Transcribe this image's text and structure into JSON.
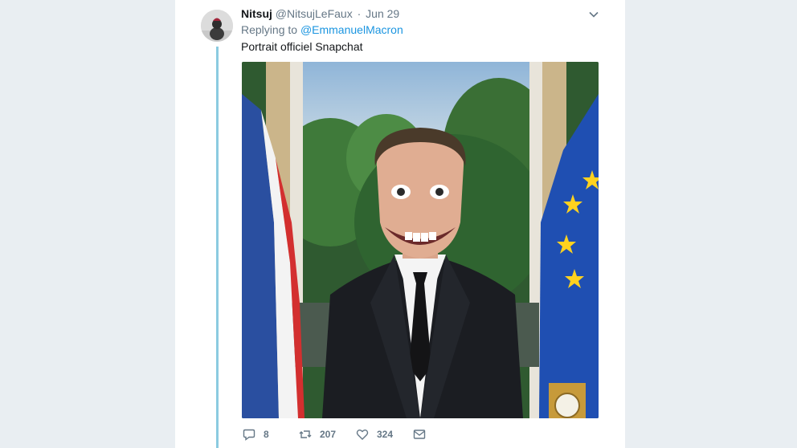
{
  "tweet": {
    "author_name": "Nitsuj",
    "author_handle": "@NitsujLeFaux",
    "separator": "·",
    "date": "Jun 29",
    "replying_prefix": "Replying to",
    "replying_to": "@EmmanuelMacron",
    "text": "Portrait officiel Snapchat",
    "media_icon": "photo",
    "thread_color": "#8bcbe0",
    "mention_color": "#1b95e0"
  },
  "actions": {
    "reply_icon": "comment-icon",
    "reply_count": "8",
    "retweet_icon": "retweet-icon",
    "retweet_count": "207",
    "like_icon": "heart-icon",
    "like_count": "324",
    "dm_icon": "envelope-icon"
  }
}
